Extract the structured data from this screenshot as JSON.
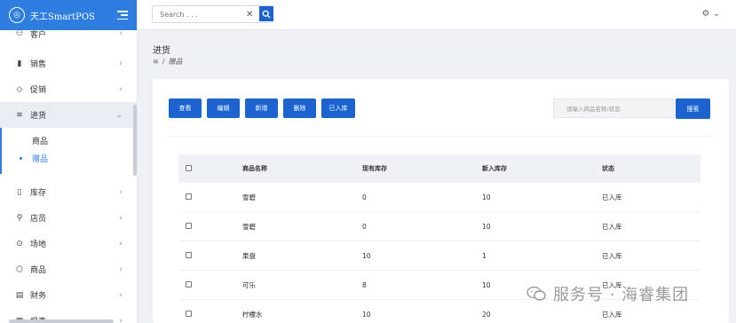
{
  "app": {
    "title": "天工SmartPOS",
    "logo_glyph": "◎"
  },
  "header": {
    "search_placeholder": "Search . . .",
    "search_value": "",
    "clear_glyph": "✕",
    "settings_glyph": "⚙ ⌄"
  },
  "sidebar": {
    "items_top": [
      {
        "label": "客户",
        "icon": "users-icon",
        "glyph": "⚇",
        "chevron": "›"
      },
      {
        "label": "销售",
        "icon": "bar-chart-icon",
        "glyph": "▮",
        "chevron": "›"
      },
      {
        "label": "促销",
        "icon": "tag-icon",
        "glyph": "◇",
        "chevron": "›"
      },
      {
        "label": "进货",
        "icon": "layers-icon",
        "glyph": "≋",
        "chevron": "⌄",
        "active": true
      }
    ],
    "submenu": [
      {
        "label": "商品",
        "current": false
      },
      {
        "label": "赠品",
        "current": true
      }
    ],
    "items_bottom": [
      {
        "label": "库存",
        "icon": "tablet-icon",
        "glyph": "▯",
        "chevron": "›"
      },
      {
        "label": "店员",
        "icon": "user-icon",
        "glyph": "⚲",
        "chevron": "›"
      },
      {
        "label": "场地",
        "icon": "map-pin-icon",
        "glyph": "⊙",
        "chevron": "›"
      },
      {
        "label": "商品",
        "icon": "box-icon",
        "glyph": "⬡",
        "chevron": "›"
      },
      {
        "label": "财务",
        "icon": "file-icon",
        "glyph": "▤",
        "chevron": "›"
      },
      {
        "label": "报表",
        "icon": "report-icon",
        "glyph": "▦",
        "chevron": "›"
      }
    ]
  },
  "page": {
    "title": "进货",
    "breadcrumb_icon": "≋",
    "breadcrumb_sep": "/",
    "breadcrumb_current": "赠品"
  },
  "toolbar": {
    "buttons": [
      "查看",
      "编辑",
      "新增",
      "删除",
      "已入库"
    ],
    "filter_placeholder": "请输入商品名称/状态",
    "search_label": "搜索"
  },
  "table": {
    "headers": [
      "商品名称",
      "现有库存",
      "新入库存",
      "状态"
    ],
    "rows": [
      [
        "雪碧",
        "0",
        "10",
        "已入库"
      ],
      [
        "雪碧",
        "0",
        "10",
        "已入库"
      ],
      [
        "果盘",
        "10",
        "1",
        "已入库"
      ],
      [
        "可乐",
        "8",
        "10",
        "已入库"
      ],
      [
        "柠檬水",
        "10",
        "20",
        "已入库"
      ]
    ]
  },
  "watermark": {
    "text": "服务号 · 海睿集团"
  },
  "colors": {
    "primary": "#1a63d1",
    "brand_bar": "#2e7de0",
    "background": "#eef2f7"
  }
}
